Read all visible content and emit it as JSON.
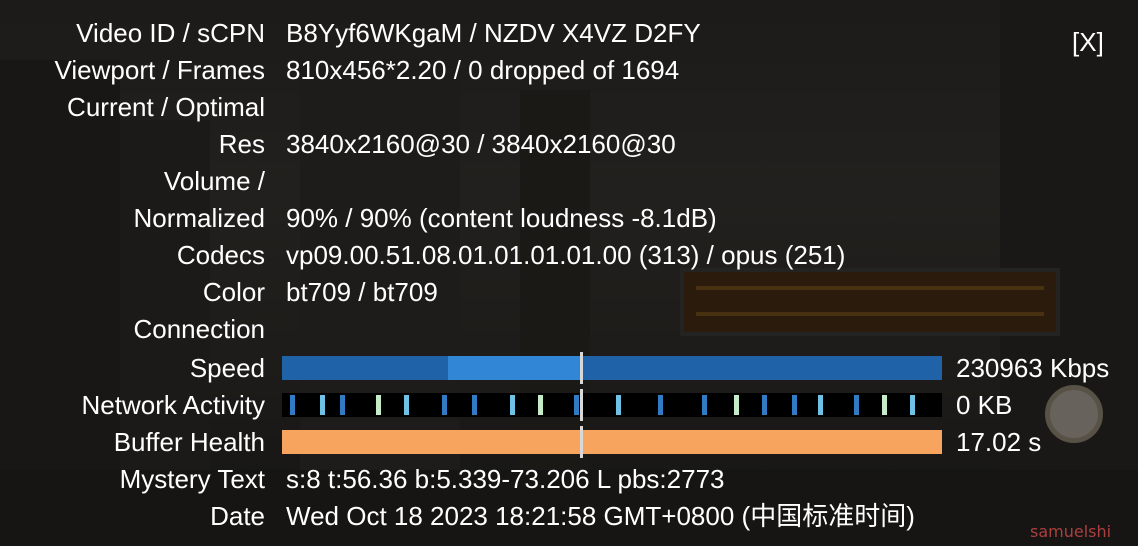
{
  "close": {
    "label": "[X]"
  },
  "rows": [
    {
      "label": "Video ID / sCPN",
      "value": "B8Yyf6WKgaM / NZDV X4VZ D2FY"
    },
    {
      "label": "Viewport / Frames",
      "value": "810x456*2.20 / 0 dropped of 1694"
    },
    {
      "label": "Current / Optimal",
      "value": ""
    },
    {
      "label": "Res",
      "value": "3840x2160@30 / 3840x2160@30"
    },
    {
      "label": "Volume /",
      "value": ""
    },
    {
      "label": "Normalized",
      "value": "90% / 90% (content loudness -8.1dB)"
    },
    {
      "label": "Codecs",
      "value": "vp09.00.51.08.01.01.01.01.00 (313) / opus (251)"
    },
    {
      "label": "Color",
      "value": "bt709 / bt709"
    },
    {
      "label": "Connection",
      "value": ""
    },
    {
      "label": "Speed",
      "value": "230963 Kbps"
    },
    {
      "label": "Network Activity",
      "value": "0 KB"
    },
    {
      "label": "Buffer Health",
      "value": "17.02 s"
    },
    {
      "label": "Mystery Text",
      "value": "s:8 t:56.36 b:5.339-73.206 L pbs:2773"
    },
    {
      "label": "Date",
      "value": "Wed Oct 18 2023 18:21:58 GMT+0800 (中国标准时间)"
    }
  ],
  "colors": {
    "speed": "#1f62a7",
    "speed_highlight": "#3187d6",
    "network": "#000000",
    "buffer": "#f6a45e"
  },
  "watermark": "samuelshi"
}
